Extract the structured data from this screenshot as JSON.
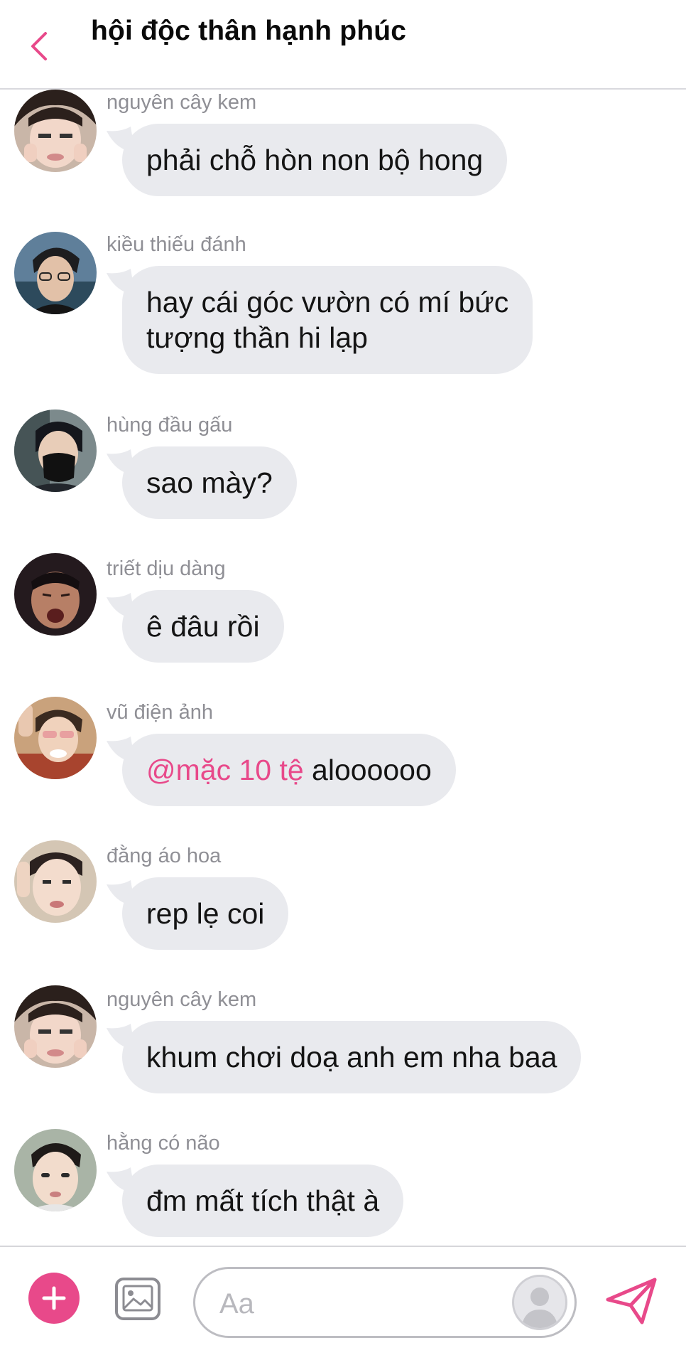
{
  "header": {
    "title": "hội độc thân hạnh phúc",
    "back_icon": "chevron-left-icon",
    "accent_color": "#e8498a"
  },
  "messages": [
    {
      "sender": "nguyên cây kem",
      "text": "phải chỗ hòn non bộ hong"
    },
    {
      "sender": "kiều thiếu đánh",
      "text_lines": [
        "hay cái góc vườn có mí bức",
        "tượng thần hi lạp"
      ]
    },
    {
      "sender": "hùng đầu gấu",
      "text": "sao mày?"
    },
    {
      "sender": "triết dịu dàng",
      "text": "ê đâu rồi"
    },
    {
      "sender": "vũ điện ảnh",
      "mention": "@mặc 10 tệ",
      "text": " aloooooo"
    },
    {
      "sender": "đằng áo hoa",
      "text": "rep lẹ coi"
    },
    {
      "sender": "nguyên cây kem",
      "text": "khum chơi doạ anh em nha baa"
    },
    {
      "sender": "hằng có não",
      "text": "đm mất tích thật à"
    }
  ],
  "composer": {
    "placeholder": "Aa",
    "value": "",
    "plus_icon": "plus-icon",
    "image_icon": "image-icon",
    "send_icon": "send-icon",
    "avatar_icon": "user-silhouette-icon"
  }
}
